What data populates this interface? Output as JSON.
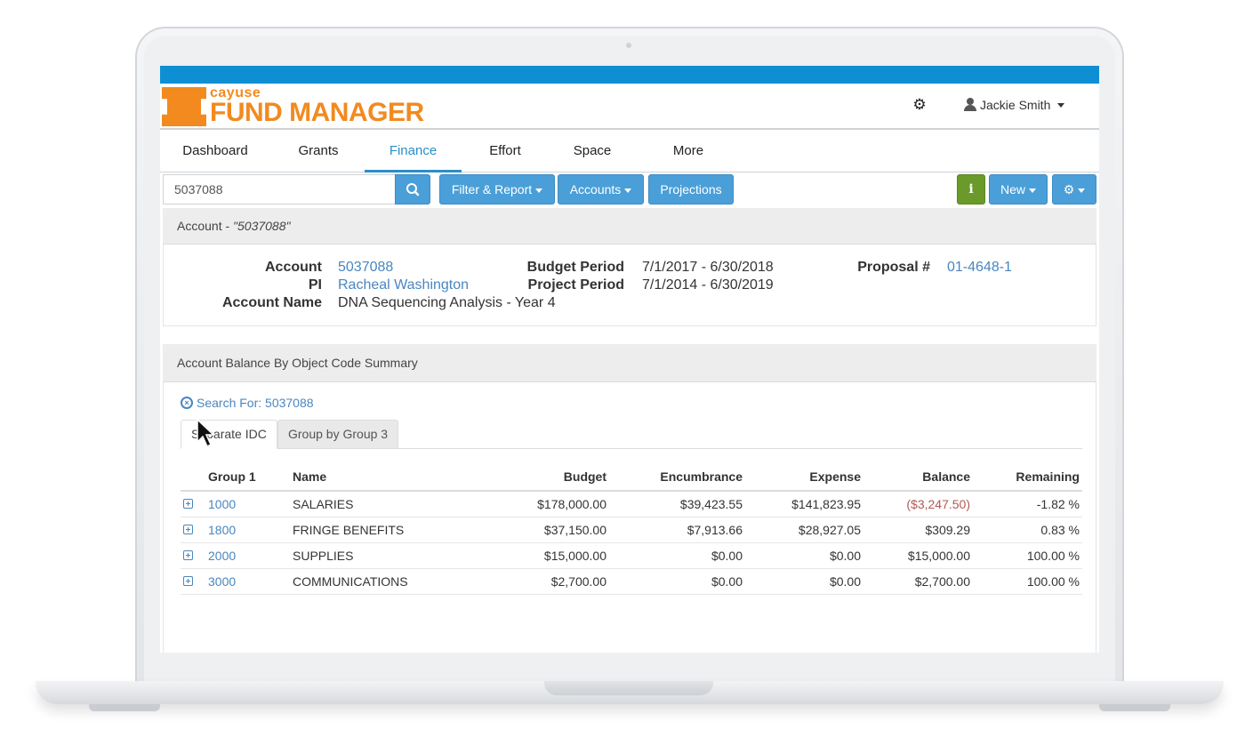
{
  "brand": {
    "small": "cayuse",
    "big": "FUND MANAGER",
    "accent": "#f28a1f",
    "bar_color": "#0e8fd3"
  },
  "header": {
    "settings_icon": "gear-icon",
    "user_icon": "user-icon",
    "user_name": "Jackie Smith"
  },
  "nav": {
    "items": [
      {
        "label": "Dashboard"
      },
      {
        "label": "Grants"
      },
      {
        "label": "Finance"
      },
      {
        "label": "Effort"
      },
      {
        "label": "Space"
      },
      {
        "label": "More"
      }
    ],
    "active": "Finance"
  },
  "toolbar": {
    "search_value": "5037088",
    "search_icon": "search-icon",
    "filter_label": "Filter & Report",
    "accounts_label": "Accounts",
    "projections_label": "Projections",
    "info_label": "i",
    "new_label": "New",
    "settings_icon": "gear-icon"
  },
  "account_panel": {
    "title_prefix": "Account - ",
    "title_query": "\"5037088\"",
    "account_label": "Account",
    "account_value": "5037088",
    "pi_label": "PI",
    "pi_value": "Racheal Washington",
    "name_label": "Account Name",
    "name_value": "DNA Sequencing Analysis - Year 4",
    "budget_period_label": "Budget Period",
    "budget_period_value": "7/1/2017 - 6/30/2018",
    "project_period_label": "Project Period",
    "project_period_value": "7/1/2014 - 6/30/2019",
    "proposal_label": "Proposal #",
    "proposal_value": "01-4648-1"
  },
  "summary_panel": {
    "title": "Account Balance By Object Code Summary",
    "search_chip": "Search For: 5037088",
    "tabs": [
      {
        "label": "Separate IDC"
      },
      {
        "label": "Group by Group 3"
      }
    ],
    "columns": [
      "Group 1",
      "Name",
      "Budget",
      "Encumbrance",
      "Expense",
      "Balance",
      "Remaining"
    ],
    "rows": [
      {
        "code": "1000",
        "name": "SALARIES",
        "budget": "$178,000.00",
        "encumbrance": "$39,423.55",
        "expense": "$141,823.95",
        "balance": "($3,247.50)",
        "remaining": "-1.82 %"
      },
      {
        "code": "1800",
        "name": "FRINGE BENEFITS",
        "budget": "$37,150.00",
        "encumbrance": "$7,913.66",
        "expense": "$28,927.05",
        "balance": "$309.29",
        "remaining": "0.83 %"
      },
      {
        "code": "2000",
        "name": "SUPPLIES",
        "budget": "$15,000.00",
        "encumbrance": "$0.00",
        "expense": "$0.00",
        "balance": "$15,000.00",
        "remaining": "100.00 %"
      },
      {
        "code": "3000",
        "name": "COMMUNICATIONS",
        "budget": "$2,700.00",
        "encumbrance": "$0.00",
        "expense": "$0.00",
        "balance": "$2,700.00",
        "remaining": "100.00 %"
      }
    ]
  }
}
